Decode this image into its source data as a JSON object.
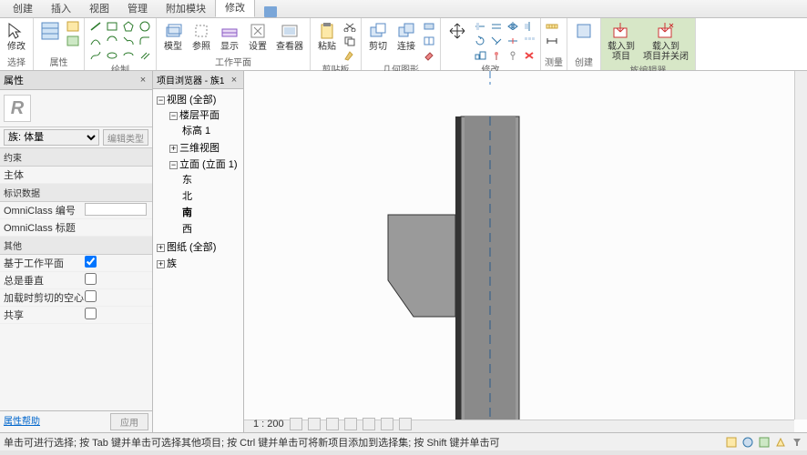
{
  "tabs": [
    "创建",
    "插入",
    "视图",
    "管理",
    "附加模块",
    "修改"
  ],
  "active_tab": 5,
  "ribbon": {
    "select": {
      "modify": "修改",
      "select": "选择",
      "props": "属性"
    },
    "props_panel": "属性",
    "clipboard": {
      "paste": "粘贴",
      "label": "剪贴板"
    },
    "geom": {
      "cut": "剪切",
      "join": "连接",
      "label": "几何图形"
    },
    "draw": {
      "label": "绘制"
    },
    "workplane": {
      "model": "模型",
      "ref": "参照",
      "show": "显示",
      "set": "设置",
      "viewer": "查看器",
      "label": "工作平面"
    },
    "modify": {
      "label": "修改"
    },
    "measure": {
      "label": "测量"
    },
    "create": {
      "label": "创建"
    },
    "editor": {
      "load": "载入到\n项目",
      "loadclose": "载入到\n项目并关闭",
      "label": "族编辑器"
    }
  },
  "props": {
    "title": "属性",
    "family_type_label": "族: 体量",
    "edit_type": "编辑类型",
    "sections": {
      "constraint": "约束",
      "host": "主体",
      "iddata": "标识数据",
      "omni_num": "OmniClass 编号",
      "omni_title": "OmniClass 标题",
      "other": "其他",
      "workplane": "基于工作平面",
      "vertical": "总是垂直",
      "voidcut": "加载时剪切的空心",
      "shared": "共享"
    },
    "values": {
      "workplane": true,
      "vertical": false,
      "voidcut": false,
      "shared": false,
      "omni_num": ""
    },
    "help": "属性帮助",
    "apply": "应用"
  },
  "browser": {
    "title": "项目浏览器 - 族1",
    "views": "视图 (全部)",
    "floorplans": "楼层平面",
    "level1": "标高 1",
    "threed": "三维视图",
    "elev": "立面 (立面 1)",
    "east": "东",
    "north": "北",
    "south": "南",
    "west": "西",
    "sheets": "图纸 (全部)",
    "families": "族"
  },
  "canvas": {
    "scale": "1 : 200"
  },
  "status": {
    "hint": "单击可进行选择; 按 Tab 键并单击可选择其他项目; 按 Ctrl 键并单击可将新项目添加到选择集; 按 Shift 键并单击可"
  }
}
